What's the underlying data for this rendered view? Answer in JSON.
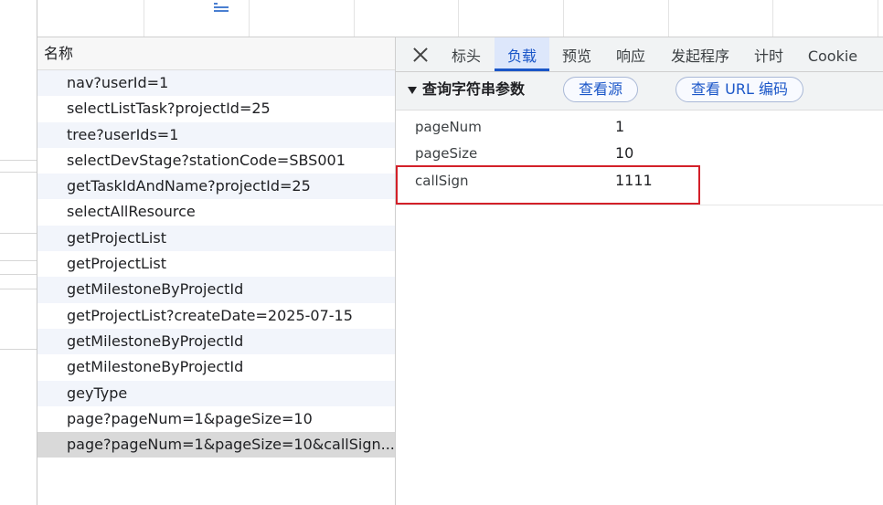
{
  "list": {
    "header": "名称",
    "rows": [
      "nav?userId=1",
      "selectListTask?projectId=25",
      "tree?userIds=1",
      "selectDevStage?stationCode=SBS001",
      "getTaskIdAndName?projectId=25",
      "selectAllResource",
      "getProjectList",
      "getProjectList",
      "getMilestoneByProjectId",
      "getProjectList?createDate=2025-07-15",
      "getMilestoneByProjectId",
      "getMilestoneByProjectId",
      "geyType",
      "page?pageNum=1&pageSize=10",
      "page?pageNum=1&pageSize=10&callSign..."
    ]
  },
  "tabs": [
    "标头",
    "负载",
    "预览",
    "响应",
    "发起程序",
    "计时",
    "Cookie"
  ],
  "active_tab": "负载",
  "section": {
    "title": "查询字符串参数",
    "view_source": "查看源",
    "view_url_encoded": "查看 URL 编码"
  },
  "params": [
    {
      "key": "pageNum",
      "value": "1"
    },
    {
      "key": "pageSize",
      "value": "10"
    },
    {
      "key": "callSign",
      "value": "1111"
    }
  ],
  "colors": {
    "accent": "#1a56c8",
    "highlight": "#d32029",
    "selected_row": "#d9d9d9"
  }
}
